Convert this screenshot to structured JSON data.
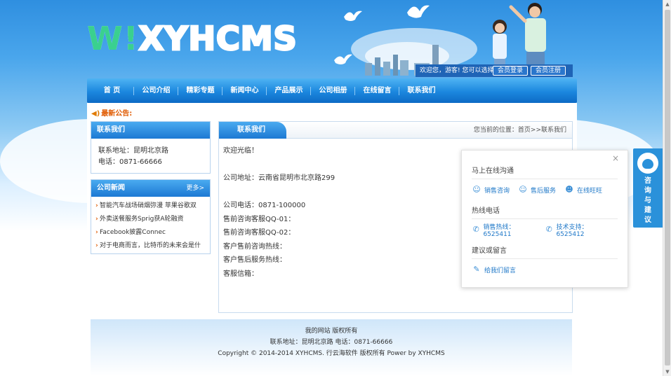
{
  "header": {
    "logo_mark": "W!",
    "logo_text": "XYHCMS",
    "welcome": "欢迎您，游客! 您可以选择",
    "login_button": "会员登录",
    "register_button": "会员注册"
  },
  "nav": {
    "items": [
      "首 页",
      "公司介绍",
      "精彩专题",
      "新闻中心",
      "产品展示",
      "公司相册",
      "在线留言",
      "联系我们"
    ]
  },
  "notice": {
    "label": "最新公告:"
  },
  "contact_box": {
    "title": "联系我们",
    "address": "联系地址：昆明北京路",
    "phone": "电话：0871-66666"
  },
  "news_box": {
    "title": "公司新闻",
    "more": "更多>",
    "items": [
      "智能汽车战场硝烟弥漫 苹果谷歌双",
      "外卖送餐服务Sprig获A轮融资",
      "Facebook披露Connec",
      "对于电商而言，比特币的未来会是什"
    ]
  },
  "main": {
    "tab": "联系我们",
    "breadcrumb": "您当前的位置：首页>>联系我们",
    "lines": [
      "欢迎光临！",
      "",
      "公司地址：云南省昆明市北京路299",
      "",
      "公司电话：0871-100000",
      "售前咨询客服QQ-01：",
      "售前咨询客服QQ-02：",
      "客户售前咨询热线：",
      "客户售后服务热线：",
      "客服信箱："
    ]
  },
  "float_panel": {
    "close": "×",
    "section1_title": "马上在线沟通",
    "section1_items": [
      "销售咨询",
      "售后服务",
      "在线旺旺"
    ],
    "section2_title": "热线电话",
    "section2_items": [
      "销售热线：6525411",
      "技术支持：6525412"
    ],
    "section3_title": "建议或留言",
    "section3_items": [
      "给我们留言"
    ]
  },
  "side_tab": {
    "text": [
      "咨",
      "询",
      "与",
      "建",
      "议"
    ]
  },
  "footer": {
    "line1": "我的网站 版权所有",
    "line2": "联系地址：昆明北京路 电话：0871-66666",
    "line3": "Copyright © 2014-2014 XYHCMS. 行云海软件 版权所有   Power by XYHCMS"
  },
  "colors": {
    "nav_blue": "#1b87de",
    "notice_orange": "#e05a00",
    "link_blue": "#1f78c8"
  }
}
